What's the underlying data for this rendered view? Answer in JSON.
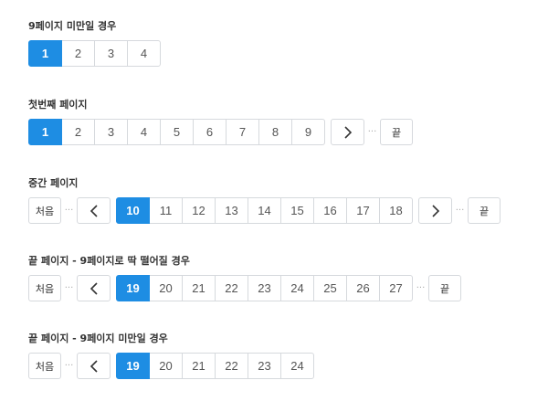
{
  "sections": [
    {
      "title": "9페이지 미만일 경우",
      "pages": [
        "1",
        "2",
        "3",
        "4"
      ],
      "active": "1"
    },
    {
      "title": "첫번째 페이지",
      "pages": [
        "1",
        "2",
        "3",
        "4",
        "5",
        "6",
        "7",
        "8",
        "9"
      ],
      "active": "1",
      "ellipsis": "···",
      "last_label": "끝"
    },
    {
      "title": "중간 페이지",
      "first_label": "처음",
      "ellipsis": "···",
      "pages": [
        "10",
        "11",
        "12",
        "13",
        "14",
        "15",
        "16",
        "17",
        "18"
      ],
      "active": "10",
      "last_label": "끝"
    },
    {
      "title": "끝 페이지 - 9페이지로 딱 떨어질 경우",
      "first_label": "처음",
      "ellipsis": "···",
      "pages": [
        "19",
        "20",
        "21",
        "22",
        "23",
        "24",
        "25",
        "26",
        "27"
      ],
      "active": "19",
      "last_label": "끝"
    },
    {
      "title": "끝 페이지 - 9페이지 미만일 경우",
      "first_label": "처음",
      "ellipsis": "···",
      "pages": [
        "19",
        "20",
        "21",
        "22",
        "23",
        "24"
      ],
      "active": "19"
    }
  ],
  "colors": {
    "accent": "#1e8de3",
    "border": "#d6d9dd",
    "text": "#333333"
  },
  "icons": {
    "prev": "chevron-left-icon",
    "next": "chevron-right-icon"
  }
}
